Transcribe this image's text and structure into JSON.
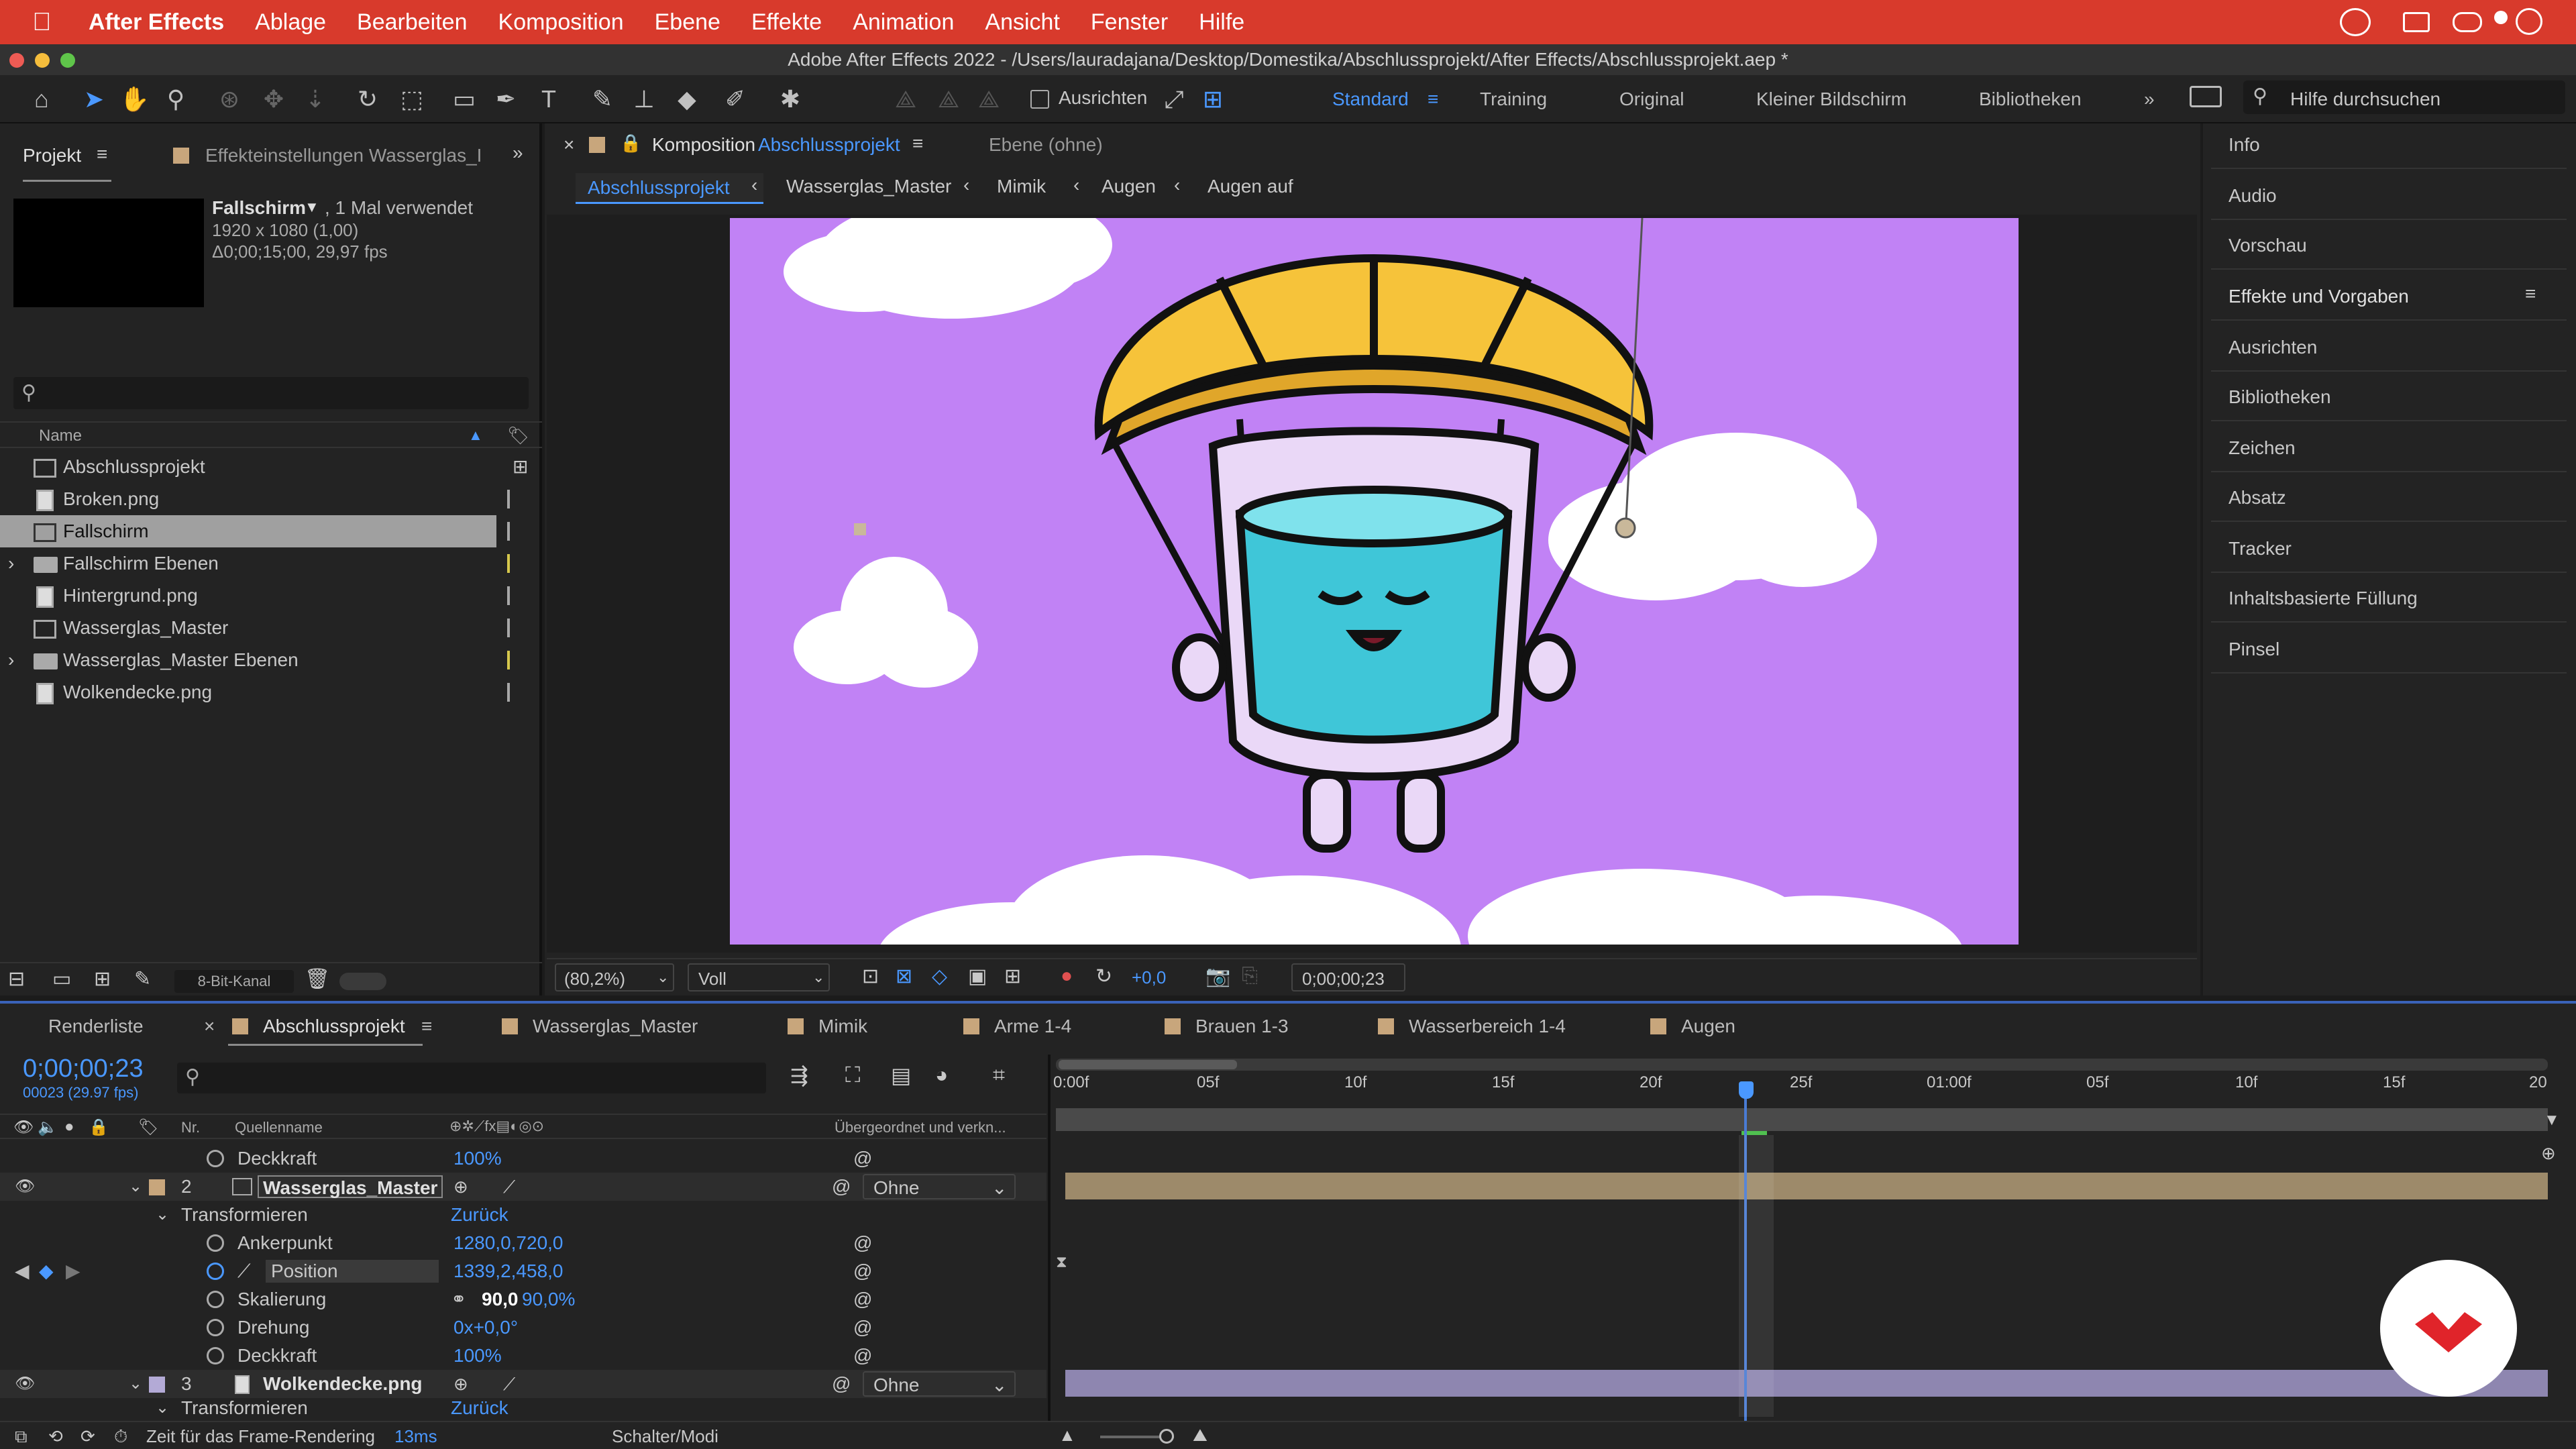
{
  "menubar": {
    "app": "After Effects",
    "items": [
      "Ablage",
      "Bearbeiten",
      "Komposition",
      "Ebene",
      "Effekte",
      "Animation",
      "Ansicht",
      "Fenster",
      "Hilfe"
    ]
  },
  "titlebar": {
    "title": "Adobe After Effects 2022 - /Users/lauradajana/Desktop/Domestika/Abschlussprojekt/After Effects/Abschlussprojekt.aep *"
  },
  "toolbar": {
    "align_label": "Ausrichten",
    "workspaces": [
      "Standard",
      "Training",
      "Original",
      "Kleiner Bildschirm",
      "Bibliotheken"
    ],
    "search_placeholder": "Hilfe durchsuchen"
  },
  "project": {
    "tab": "Projekt",
    "tab2": "Effekteinstellungen Wasserglas_I",
    "item_name": "Fallschirm",
    "item_used": ", 1 Mal verwendet",
    "item_size": "1920 x 1080 (1,00)",
    "item_dur": "Δ0;00;15;00, 29,97 fps",
    "col_name": "Name",
    "items": [
      {
        "label": "Abschlussprojekt",
        "type": "comp",
        "color": "#a8a8a8",
        "expand": ""
      },
      {
        "label": "Broken.png",
        "type": "file",
        "color": "#a8a8a8",
        "expand": ""
      },
      {
        "label": "Fallschirm",
        "type": "comp",
        "color": "#a8a8a8",
        "expand": ""
      },
      {
        "label": "Fallschirm Ebenen",
        "type": "folder",
        "color": "#d6c84c",
        "expand": "›"
      },
      {
        "label": "Hintergrund.png",
        "type": "file",
        "color": "#a8a8a8",
        "expand": ""
      },
      {
        "label": "Wasserglas_Master",
        "type": "comp",
        "color": "#a8a8a8",
        "expand": ""
      },
      {
        "label": "Wasserglas_Master Ebenen",
        "type": "folder",
        "color": "#d6c84c",
        "expand": "›"
      },
      {
        "label": "Wolkendecke.png",
        "type": "file",
        "color": "#a8a8a8",
        "expand": ""
      }
    ],
    "bitdepth": "8-Bit-Kanal"
  },
  "comp": {
    "tab_prefix": "Komposition",
    "tab_name": "Abschlussprojekt",
    "layer_tab": "Ebene (ohne)",
    "breadcrumbs": [
      "Abschlussprojekt",
      "Wasserglas_Master",
      "Mimik",
      "Augen",
      "Augen auf"
    ],
    "zoom": "(80,2%)",
    "quality": "Voll",
    "exposure": "+0,0",
    "timecode": "0;00;00;23"
  },
  "right": {
    "items": [
      "Info",
      "Audio",
      "Vorschau",
      "Effekte und Vorgaben",
      "Ausrichten",
      "Bibliotheken",
      "Zeichen",
      "Absatz",
      "Tracker",
      "Inhaltsbasierte Füllung",
      "Pinsel"
    ]
  },
  "timeline": {
    "tabs": [
      "Renderliste",
      "Abschlussprojekt",
      "Wasserglas_Master",
      "Mimik",
      "Arme 1-4",
      "Brauen 1-3",
      "Wasserbereich 1-4",
      "Augen"
    ],
    "tab_colors": [
      "#c8a67c",
      "#c8a67c",
      "#c8a67c",
      "#c8a67c",
      "#c8a67c",
      "#c8a67c",
      "#c8a67c"
    ],
    "time": "0;00;00;23",
    "fps": "00023 (29.97 fps)",
    "col_nr": "Nr.",
    "col_src": "Quellenname",
    "col_parent": "Übergeordnet und verkn...",
    "ruler": [
      "0:00f",
      "05f",
      "10f",
      "15f",
      "20f",
      "25f",
      "01:00f",
      "05f",
      "10f",
      "15f",
      "20"
    ],
    "rows": {
      "deckkraft1": {
        "label": "Deckkraft",
        "value": "100%"
      },
      "layer2": {
        "nr": "2",
        "name": "Wasserglas_Master",
        "parent": "Ohne"
      },
      "transform": {
        "label": "Transformieren",
        "reset": "Zurück"
      },
      "anchor": {
        "label": "Ankerpunkt",
        "value": "1280,0,720,0"
      },
      "position": {
        "label": "Position",
        "value": "1339,2,458,0"
      },
      "scale": {
        "label": "Skalierung",
        "v1": "90,0",
        "v2": "90,0%"
      },
      "rotation": {
        "label": "Drehung",
        "value": "0x+0,0°"
      },
      "deckkraft2": {
        "label": "Deckkraft",
        "value": "100%"
      },
      "layer3": {
        "nr": "3",
        "name": "Wolkendecke.png",
        "parent": "Ohne"
      },
      "transform3": {
        "label": "Transformieren",
        "reset": "Zurück"
      }
    },
    "status": {
      "label": "Zeit für das Frame-Rendering",
      "value": "13ms",
      "switch": "Schalter/Modi"
    }
  }
}
